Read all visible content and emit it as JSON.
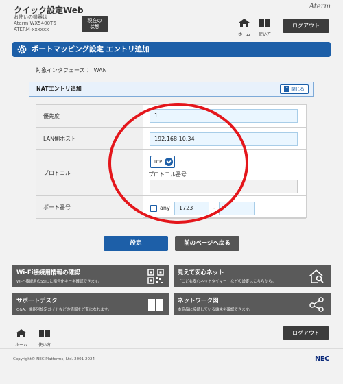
{
  "header": {
    "site_title": "クイック設定Web",
    "device_lines": [
      "お使いの機器は",
      "Aterm WX5400T6",
      "ATERM-xxxxxx"
    ],
    "status_button": [
      "現在の",
      "状態"
    ],
    "brand": "Aterm",
    "home_label": "ホーム",
    "howto_label": "使い方",
    "logout_label": "ログアウト"
  },
  "page": {
    "title": "ポートマッピング設定 エントリ追加",
    "target_interface": "対象インタフェース ： WAN",
    "section_title": "NATエントリ追加",
    "close_label": "閉じる"
  },
  "form": {
    "priority_label": "優先度",
    "priority_value": "1",
    "lan_host_label": "LAN側ホスト",
    "lan_host_value": "192.168.10.34",
    "protocol_label": "プロトコル",
    "protocol_value": "TCP",
    "protocol_number_label": "プロトコル番号",
    "protocol_number_value": "",
    "port_label": "ポート番号",
    "port_any_label": "any",
    "port_any_checked": false,
    "port_from": "1723",
    "port_separator": "-",
    "port_to": ""
  },
  "actions": {
    "submit_label": "設定",
    "back_label": "前のページへ戻る"
  },
  "tiles": [
    {
      "title": "Wi-Fi接続用情報の確認",
      "desc": "Wi-Fi接続用のSSIDと暗号化キーを確認できます。",
      "icon": "qr-code-icon"
    },
    {
      "title": "見えて安心ネット",
      "desc": "「こども安心ネットタイマー」などの設定はこちらから。",
      "icon": "house-search-icon"
    },
    {
      "title": "サポートデスク",
      "desc": "Q&A、機能別設定ガイドなどの情報をご覧になれます。",
      "icon": "book-icon"
    },
    {
      "title": "ネットワーク図",
      "desc": "本商品に接続している端末を確認できます。",
      "icon": "network-share-icon"
    }
  ],
  "footer": {
    "home_label": "ホーム",
    "howto_label": "使い方",
    "logout_label": "ログアウト",
    "copyright": "Copyright© NEC Platforms, Ltd. 2001-2024",
    "brand": "NEC"
  },
  "colors": {
    "primary_blue": "#1d5fa8",
    "dark_gray": "#3c3c3c",
    "annotation_red": "#e4161b"
  }
}
